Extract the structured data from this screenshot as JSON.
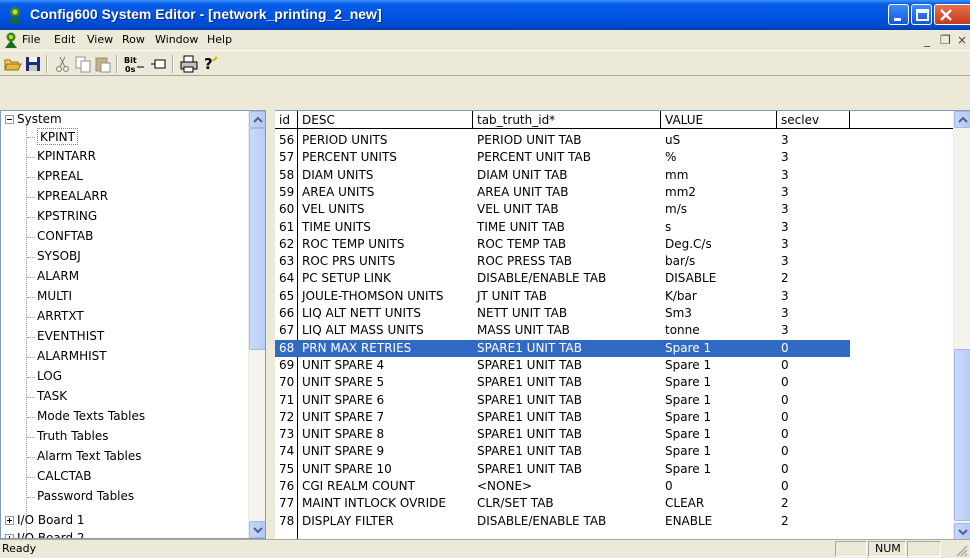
{
  "window": {
    "title": "Config600 System Editor - [network_printing_2_new]"
  },
  "menu": {
    "items": [
      "File",
      "Edit",
      "View",
      "Row",
      "Window",
      "Help"
    ],
    "mdi_min": "_",
    "mdi_restore": "❐",
    "mdi_close": "×"
  },
  "toolbar": {
    "buttons": [
      "open-icon",
      "save-icon",
      "cut-icon",
      "copy-icon",
      "paste-icon",
      "binary-icon",
      "insert-row-icon",
      "print-icon",
      "help-icon"
    ]
  },
  "tree": {
    "root": "System",
    "children": [
      "KPINT",
      "KPINTARR",
      "KPREAL",
      "KPREALARR",
      "KPSTRING",
      "CONFTAB",
      "SYSOBJ",
      "ALARM",
      "MULTI",
      "ARRTXT",
      "EVENTHIST",
      "ALARMHIST",
      "LOG",
      "TASK",
      "Mode Texts Tables",
      "Truth Tables",
      "Alarm Text Tables",
      "CALCTAB",
      "Password Tables"
    ],
    "selected": "KPINT",
    "collapsed": [
      "I/O Board 1",
      "I/O Board 2"
    ]
  },
  "grid": {
    "columns": [
      "id",
      "DESC",
      "tab_truth_id*",
      "VALUE",
      "seclev"
    ],
    "selected_id": "68",
    "rows": [
      [
        "56",
        "PERIOD UNITS",
        "PERIOD UNIT TAB",
        "uS",
        "3"
      ],
      [
        "57",
        "PERCENT UNITS",
        "PERCENT UNIT TAB",
        "%",
        "3"
      ],
      [
        "58",
        "DIAM UNITS",
        "DIAM UNIT TAB",
        "mm",
        "3"
      ],
      [
        "59",
        "AREA UNITS",
        "AREA UNIT TAB",
        "mm2",
        "3"
      ],
      [
        "60",
        "VEL UNITS",
        "VEL UNIT TAB",
        "m/s",
        "3"
      ],
      [
        "61",
        "TIME UNITS",
        "TIME UNIT TAB",
        "s",
        "3"
      ],
      [
        "62",
        "ROC TEMP UNITS",
        "ROC TEMP TAB",
        "Deg.C/s",
        "3"
      ],
      [
        "63",
        "ROC PRS UNITS",
        "ROC PRESS TAB",
        "bar/s",
        "3"
      ],
      [
        "64",
        "PC SETUP LINK",
        "DISABLE/ENABLE TAB",
        "DISABLE",
        "2"
      ],
      [
        "65",
        "JOULE-THOMSON UNITS",
        "JT UNIT TAB",
        "K/bar",
        "3"
      ],
      [
        "66",
        "LIQ ALT NETT UNITS",
        "NETT UNIT TAB",
        "Sm3",
        "3"
      ],
      [
        "67",
        "LIQ ALT MASS UNITS",
        "MASS UNIT TAB",
        "tonne",
        "3"
      ],
      [
        "68",
        "PRN MAX RETRIES",
        "SPARE1 UNIT TAB",
        "Spare 1",
        "0"
      ],
      [
        "69",
        "UNIT SPARE 4",
        "SPARE1 UNIT TAB",
        "Spare 1",
        "0"
      ],
      [
        "70",
        "UNIT SPARE 5",
        "SPARE1 UNIT TAB",
        "Spare 1",
        "0"
      ],
      [
        "71",
        "UNIT SPARE 6",
        "SPARE1 UNIT TAB",
        "Spare 1",
        "0"
      ],
      [
        "72",
        "UNIT SPARE 7",
        "SPARE1 UNIT TAB",
        "Spare 1",
        "0"
      ],
      [
        "73",
        "UNIT SPARE 8",
        "SPARE1 UNIT TAB",
        "Spare 1",
        "0"
      ],
      [
        "74",
        "UNIT SPARE 9",
        "SPARE1 UNIT TAB",
        "Spare 1",
        "0"
      ],
      [
        "75",
        "UNIT SPARE 10",
        "SPARE1 UNIT TAB",
        "Spare 1",
        "0"
      ],
      [
        "76",
        "CGI REALM COUNT",
        "<NONE>",
        "0",
        "0"
      ],
      [
        "77",
        "MAINT INTLOCK OVRIDE",
        "CLR/SET TAB",
        "CLEAR",
        "2"
      ],
      [
        "78",
        "DISPLAY FILTER",
        "DISABLE/ENABLE TAB",
        "ENABLE",
        "2"
      ]
    ]
  },
  "status": {
    "text": "Ready",
    "num": "NUM"
  }
}
